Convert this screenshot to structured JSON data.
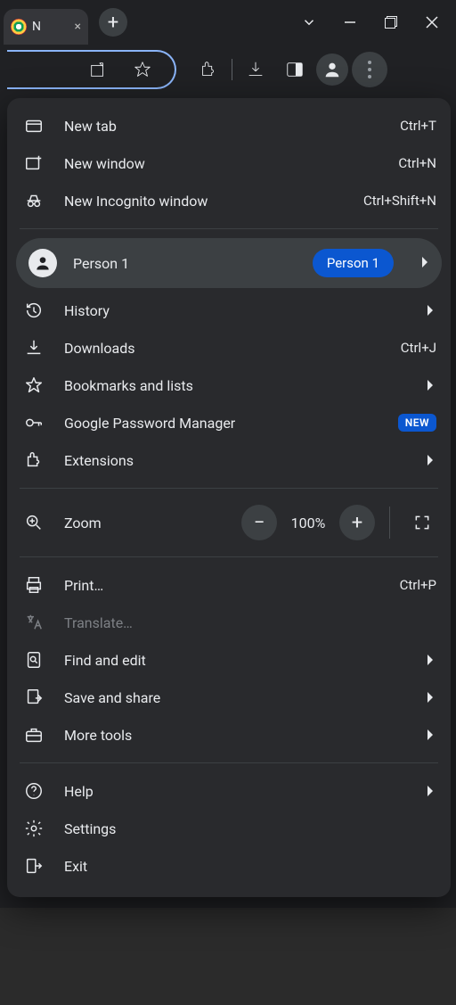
{
  "tab": {
    "title": "N",
    "close_glyph": "×"
  },
  "newtab_glyph": "+",
  "toolbar": {},
  "menu": {
    "new_tab": {
      "label": "New tab",
      "shortcut": "Ctrl+T"
    },
    "new_window": {
      "label": "New window",
      "shortcut": "Ctrl+N"
    },
    "incognito": {
      "label": "New Incognito window",
      "shortcut": "Ctrl+Shift+N"
    },
    "profile": {
      "label": "Person 1",
      "pill": "Person 1"
    },
    "history": {
      "label": "History"
    },
    "downloads": {
      "label": "Downloads",
      "shortcut": "Ctrl+J"
    },
    "bookmarks": {
      "label": "Bookmarks and lists"
    },
    "passwords": {
      "label": "Google Password Manager",
      "badge": "NEW"
    },
    "extensions": {
      "label": "Extensions"
    },
    "zoom": {
      "label": "Zoom",
      "value": "100%",
      "minus": "−",
      "plus": "+"
    },
    "print": {
      "label": "Print…",
      "shortcut": "Ctrl+P"
    },
    "translate": {
      "label": "Translate…"
    },
    "find": {
      "label": "Find and edit"
    },
    "save_share": {
      "label": "Save and share"
    },
    "more_tools": {
      "label": "More tools"
    },
    "help": {
      "label": "Help"
    },
    "settings": {
      "label": "Settings"
    },
    "exit": {
      "label": "Exit"
    }
  }
}
